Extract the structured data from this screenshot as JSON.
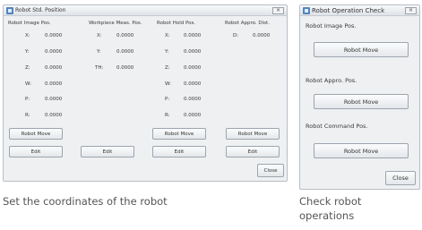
{
  "position_window": {
    "title": "Robot Std. Position",
    "close_glyph": "×",
    "groups": [
      {
        "header": "Robot Image Pos.",
        "rows": [
          {
            "axis": "X:",
            "value": "0.0000"
          },
          {
            "axis": "Y:",
            "value": "0.0000"
          },
          {
            "axis": "Z:",
            "value": "0.0000"
          },
          {
            "axis": "W:",
            "value": "0.0000"
          },
          {
            "axis": "P:",
            "value": "0.0000"
          },
          {
            "axis": "R:",
            "value": "0.0000"
          }
        ]
      },
      {
        "header": "Workpiece Meas. Pos.",
        "rows": [
          {
            "axis": "X:",
            "value": "0.0000"
          },
          {
            "axis": "Y:",
            "value": "0.0000"
          },
          {
            "axis": "TH:",
            "value": "0.0000"
          }
        ]
      },
      {
        "header": "Robot Hold Pos.",
        "rows": [
          {
            "axis": "X:",
            "value": "0.0000"
          },
          {
            "axis": "Y:",
            "value": "0.0000"
          },
          {
            "axis": "Z:",
            "value": "0.0000"
          },
          {
            "axis": "W:",
            "value": "0.0000"
          },
          {
            "axis": "P:",
            "value": "0.0000"
          },
          {
            "axis": "R:",
            "value": "0.0000"
          }
        ]
      },
      {
        "header": "Robot Appro. Dist.",
        "rows": [
          {
            "axis": "D:",
            "value": "0.0000"
          }
        ]
      }
    ],
    "robot_move_label": "Robot Move",
    "edit_label": "Edit",
    "close_label": "Close"
  },
  "operation_window": {
    "title": "Robot Operation Check",
    "close_glyph": "×",
    "sections": [
      {
        "label": "Robot Image Pos.",
        "button": "Robot Move"
      },
      {
        "label": "Robot Appro. Pos.",
        "button": "Robot Move"
      },
      {
        "label": "Robot Command Pos.",
        "button": "Robot Move"
      }
    ],
    "close_label": "Close"
  },
  "captions": {
    "left": "Set the coordinates of the robot",
    "right_line1": "Check robot",
    "right_line2": "operations"
  }
}
